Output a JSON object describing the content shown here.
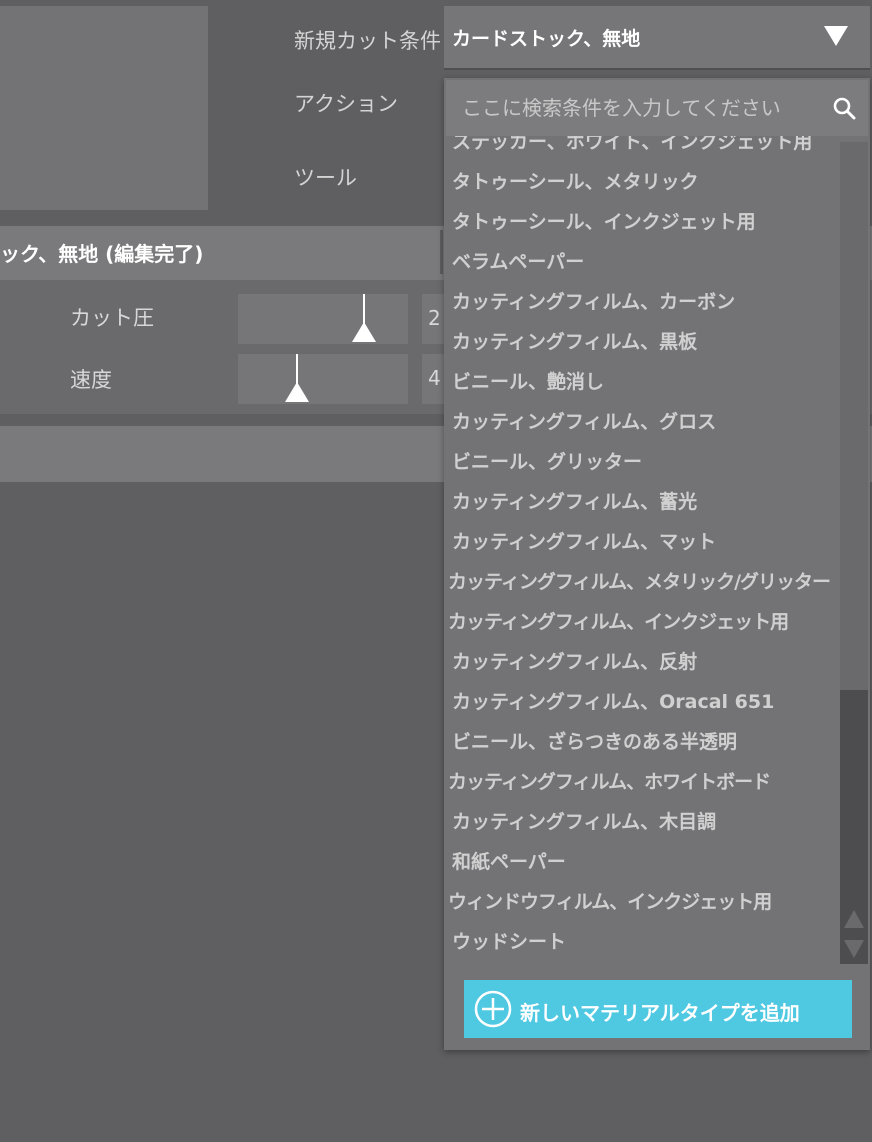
{
  "form": {
    "new_cut_label": "新規カット条件",
    "action_label": "アクション",
    "tool_label": "ツール",
    "material_select_value": "カードストック、無地"
  },
  "cut_settings": {
    "header": "ック、無地 (編集完了)",
    "pressure_label": "カット圧",
    "pressure_value": "2",
    "speed_label": "速度",
    "speed_value": "4"
  },
  "material_list": {
    "search_placeholder": "ここに検索条件を入力してください",
    "items": [
      "ステッカー、ホワイト、インクジェット用",
      "タトゥーシール、メタリック",
      "タトゥーシール、インクジェット用",
      "ベラムペーパー",
      "カッティングフィルム、カーボン",
      "カッティングフィルム、黒板",
      "ビニール、艶消し",
      "カッティングフィルム、グロス",
      "ビニール、グリッター",
      "カッティングフィルム、蓄光",
      "カッティングフィルム、マット",
      "カッティングフィルム、メタリック/グリッター",
      "カッティングフィルム、インクジェット用",
      "カッティングフィルム、反射",
      "カッティングフィルム、Oracal 651",
      "ビニール、ざらつきのある半透明",
      "カッティングフィルム、ホワイトボード",
      "カッティングフィルム、木目調",
      "和紙ペーパー",
      "ウィンドウフィルム、インクジェット用",
      "ウッドシート"
    ],
    "add_button_label": "新しいマテリアルタイプを追加"
  },
  "icons": {
    "dropdown": "triangle-down-icon",
    "search": "search-icon",
    "add": "plus-circle-icon",
    "scroll_up": "scroll-up-icon",
    "scroll_down": "scroll-down-icon"
  },
  "colors": {
    "background": "#5f5e60",
    "accent": "#4fc8e2"
  }
}
